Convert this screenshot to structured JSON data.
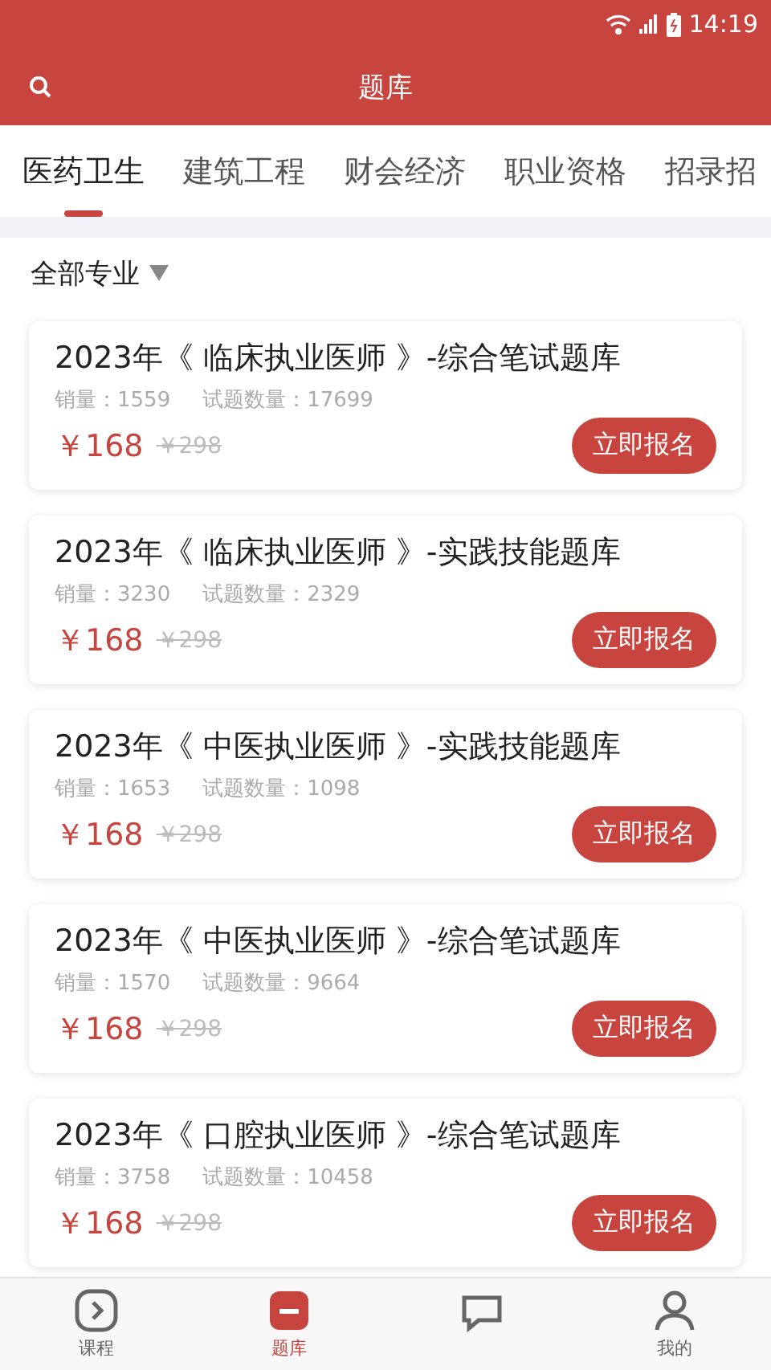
{
  "status_bar": {
    "time": "14:19"
  },
  "header": {
    "title": "题库"
  },
  "tabs": [
    {
      "label": "医药卫生",
      "selected": true
    },
    {
      "label": "建筑工程",
      "selected": false
    },
    {
      "label": "财会经济",
      "selected": false
    },
    {
      "label": "职业资格",
      "selected": false
    },
    {
      "label": "招录招",
      "selected": false
    }
  ],
  "filter": {
    "label": "全部专业"
  },
  "courses": [
    {
      "title": "2023年《 临床执业医师 》-综合笔试题库",
      "sales": "销量：1559",
      "questions": "试题数量：17699",
      "price": "￥168",
      "original_price": "￥298",
      "button": "立即报名"
    },
    {
      "title": "2023年《 临床执业医师 》-实践技能题库",
      "sales": "销量：3230",
      "questions": "试题数量：2329",
      "price": "￥168",
      "original_price": "￥298",
      "button": "立即报名"
    },
    {
      "title": "2023年《 中医执业医师 》-实践技能题库",
      "sales": "销量：1653",
      "questions": "试题数量：1098",
      "price": "￥168",
      "original_price": "￥298",
      "button": "立即报名"
    },
    {
      "title": "2023年《 中医执业医师 》-综合笔试题库",
      "sales": "销量：1570",
      "questions": "试题数量：9664",
      "price": "￥168",
      "original_price": "￥298",
      "button": "立即报名"
    },
    {
      "title": "2023年《 口腔执业医师 》-综合笔试题库",
      "sales": "销量：3758",
      "questions": "试题数量：10458",
      "price": "￥168",
      "original_price": "￥298",
      "button": "立即报名"
    }
  ],
  "bottom_nav": [
    {
      "kind": "play",
      "label": "课程",
      "selected": false
    },
    {
      "kind": "bank",
      "label": "题库",
      "selected": true
    },
    {
      "kind": "chat",
      "selected": false
    },
    {
      "kind": "user",
      "label": "我的",
      "selected": false
    }
  ]
}
